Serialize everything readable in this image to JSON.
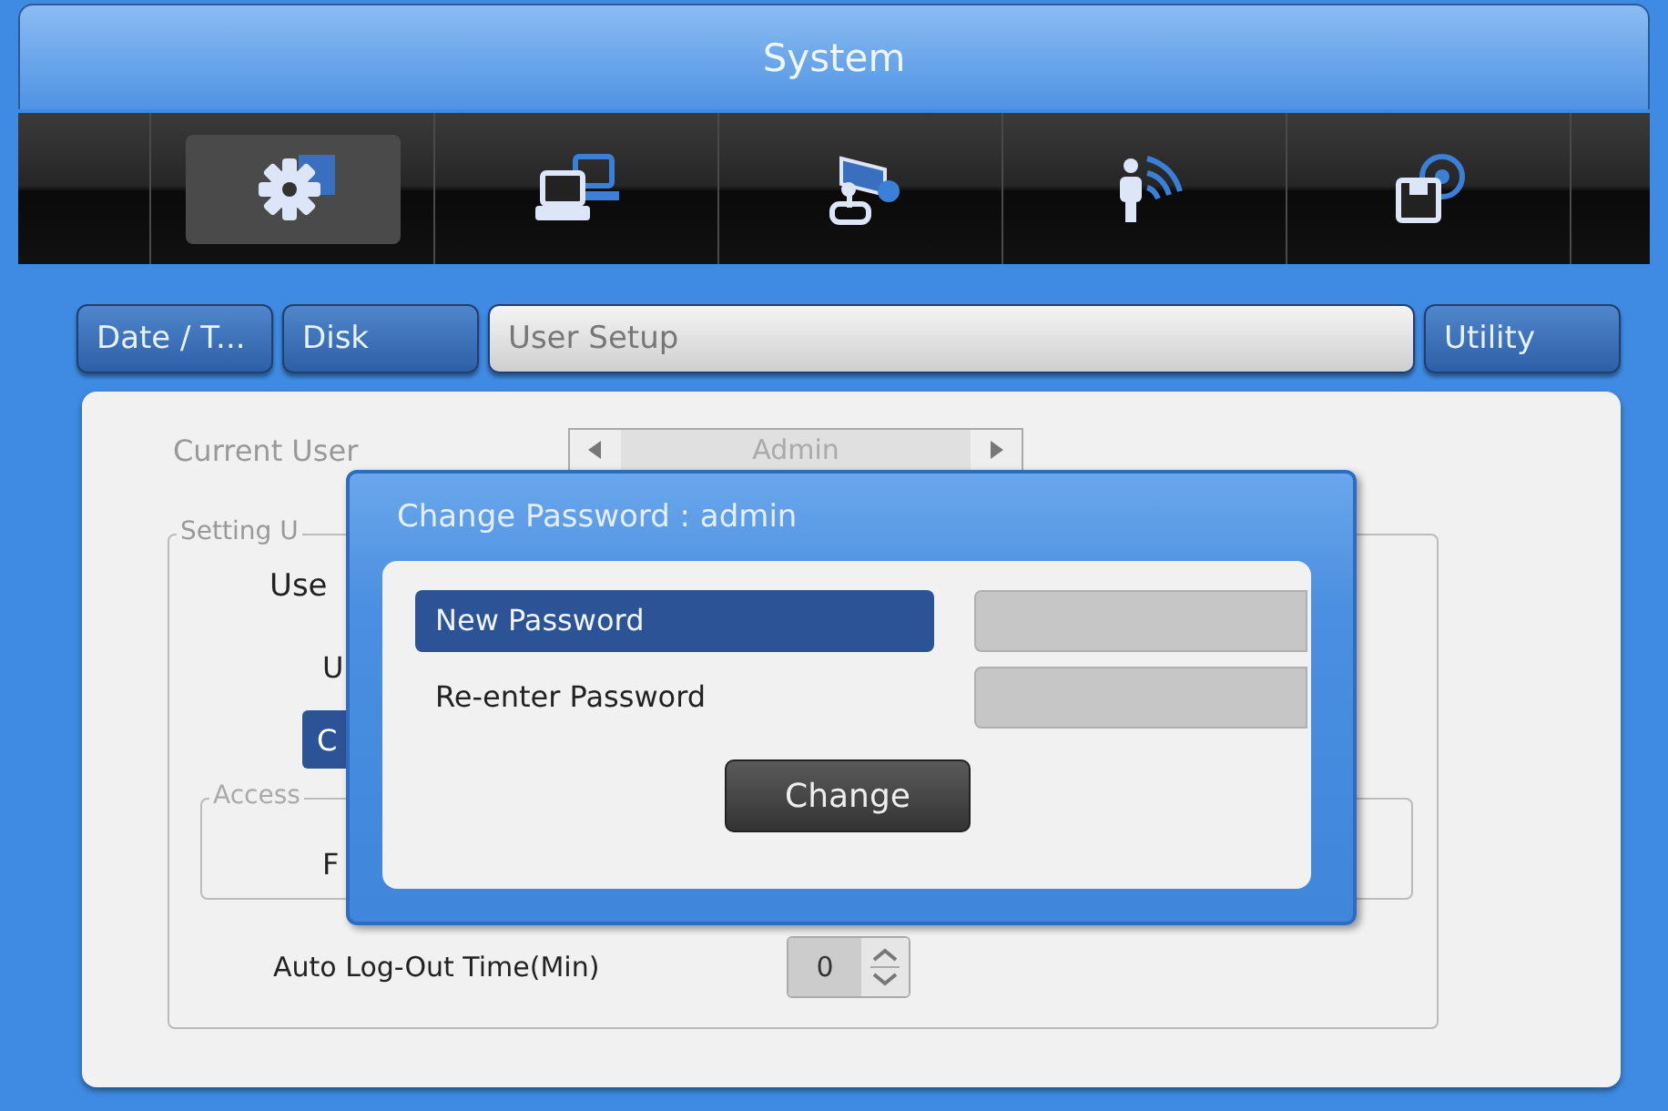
{
  "window": {
    "title": "System"
  },
  "toolbar": [
    {
      "kind": "gear",
      "selected": true
    },
    {
      "kind": "network",
      "selected": false
    },
    {
      "kind": "camera",
      "selected": false
    },
    {
      "kind": "signal",
      "selected": false
    },
    {
      "kind": "storage",
      "selected": false
    }
  ],
  "tabs": [
    {
      "label": "Date / T...",
      "selected": false
    },
    {
      "label": "Disk",
      "selected": false
    },
    {
      "label": "User Setup",
      "selected": true
    },
    {
      "label": "Utility",
      "selected": false
    }
  ],
  "settings": {
    "current_user": {
      "label": "Current User",
      "value": "Admin",
      "disabled": true
    },
    "group": {
      "legend": "Setting U",
      "user_label": "Use",
      "row_label": "U",
      "button": "C",
      "access": {
        "legend": "Access",
        "label": "F"
      }
    },
    "auto_logout": {
      "label": "Auto Log-Out Time(Min)",
      "value": "0"
    }
  },
  "dialog": {
    "title": "Change Password : admin",
    "fields": [
      {
        "label": "New Password",
        "selected": true
      },
      {
        "label": "Re-enter Password",
        "selected": false
      }
    ],
    "button": "Change"
  }
}
